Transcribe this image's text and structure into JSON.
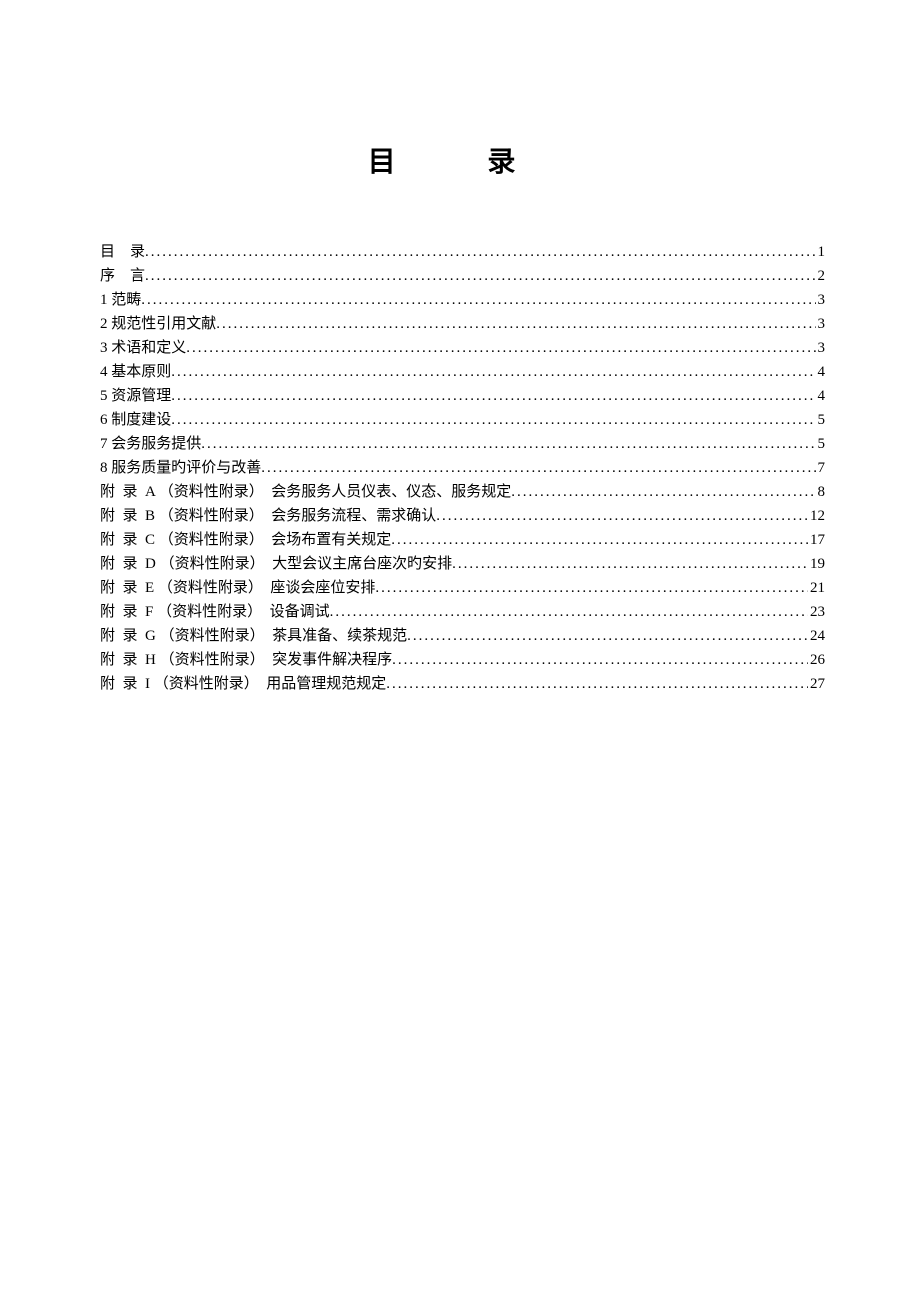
{
  "title": "目  录",
  "toc": [
    {
      "label": "目    录",
      "page": "1"
    },
    {
      "label": "序    言",
      "page": "2"
    },
    {
      "label": "1 范畴",
      "page": "3"
    },
    {
      "label": "2 规范性引用文献",
      "page": "3"
    },
    {
      "label": "3 术语和定义",
      "page": "3"
    },
    {
      "label": "4 基本原则",
      "page": "4"
    },
    {
      "label": "5 资源管理",
      "page": "4"
    },
    {
      "label": "6 制度建设",
      "page": "5"
    },
    {
      "label": "7 会务服务提供",
      "page": "5"
    },
    {
      "label": "8 服务质量旳评价与改善",
      "page": "7"
    },
    {
      "label": "附  录  A （资料性附录）  会务服务人员仪表、仪态、服务规定",
      "page": "8"
    },
    {
      "label": "附  录  B （资料性附录）  会务服务流程、需求确认",
      "page": "12"
    },
    {
      "label": "附  录  C （资料性附录）  会场布置有关规定",
      "page": "17"
    },
    {
      "label": "附  录  D （资料性附录）  大型会议主席台座次旳安排",
      "page": "19"
    },
    {
      "label": "附  录  E （资料性附录）  座谈会座位安排",
      "page": "21"
    },
    {
      "label": "附  录  F （资料性附录）  设备调试",
      "page": "23"
    },
    {
      "label": "附  录  G （资料性附录）  茶具准备、续茶规范",
      "page": "24"
    },
    {
      "label": "附  录  H （资料性附录）  突发事件解决程序",
      "page": "26"
    },
    {
      "label": "附  录  I （资料性附录）  用品管理规范规定",
      "page": "27"
    }
  ]
}
